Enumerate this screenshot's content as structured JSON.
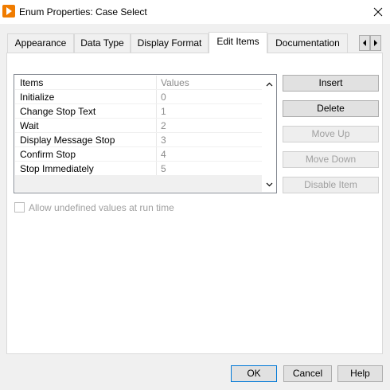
{
  "window": {
    "title": "Enum Properties: Case Select",
    "icon": "labview-run-arrow-icon",
    "close_icon": "close-icon"
  },
  "tabs": [
    {
      "label": "Appearance",
      "active": false
    },
    {
      "label": "Data Type",
      "active": false
    },
    {
      "label": "Display Format",
      "active": false
    },
    {
      "label": "Edit Items",
      "active": true
    },
    {
      "label": "Documentation",
      "active": false
    }
  ],
  "tab_scroll": {
    "left_icon": "chevron-left-icon",
    "right_icon": "chevron-right-icon"
  },
  "table": {
    "headers": {
      "items": "Items",
      "values": "Values"
    },
    "rows": [
      {
        "item": "Initialize",
        "value": "0"
      },
      {
        "item": "Change Stop Text",
        "value": "1"
      },
      {
        "item": "Wait",
        "value": "2"
      },
      {
        "item": "Display Message Stop",
        "value": "3"
      },
      {
        "item": "Confirm Stop",
        "value": "4"
      },
      {
        "item": "Stop Immediately",
        "value": "5"
      }
    ]
  },
  "side_buttons": {
    "insert": "Insert",
    "delete": "Delete",
    "move_up": "Move Up",
    "move_down": "Move Down",
    "disable_item": "Disable Item"
  },
  "allow_undefined": {
    "label": "Allow undefined values at run time",
    "checked": false,
    "enabled": false
  },
  "dialog_buttons": {
    "ok": "OK",
    "cancel": "Cancel",
    "help": "Help"
  },
  "colors": {
    "accent_icon": "#f07c00",
    "default_button_border": "#0078d7",
    "disabled_text": "#a0a0a0"
  }
}
